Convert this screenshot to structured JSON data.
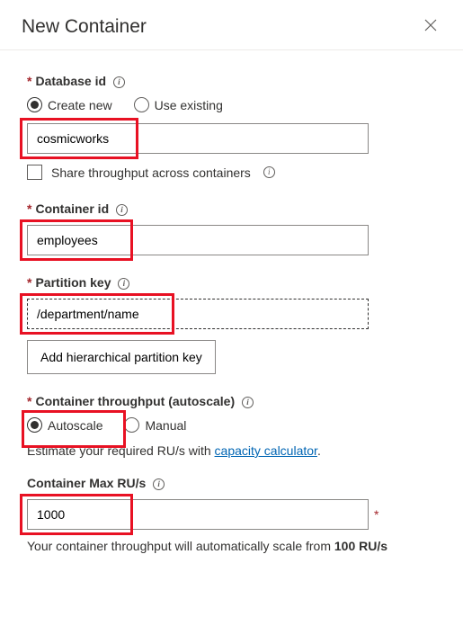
{
  "header": {
    "title": "New Container"
  },
  "database": {
    "label": "Database id",
    "create_new_label": "Create new",
    "use_existing_label": "Use existing",
    "value": "cosmicworks",
    "share_throughput_label": "Share throughput across containers"
  },
  "container": {
    "label": "Container id",
    "value": "employees"
  },
  "partition": {
    "label": "Partition key",
    "value": "/department/name",
    "hier_button_label": "Add hierarchical partition key"
  },
  "throughput": {
    "label": "Container throughput (autoscale)",
    "autoscale_label": "Autoscale",
    "manual_label": "Manual",
    "estimate_prefix": "Estimate your required RU/s with ",
    "estimate_link": "capacity calculator",
    "estimate_suffix": "."
  },
  "ru": {
    "label": "Container Max RU/s",
    "value": "1000",
    "footnote_prefix": "Your container throughput will automatically scale from ",
    "footnote_bold": "100 RU/s"
  }
}
